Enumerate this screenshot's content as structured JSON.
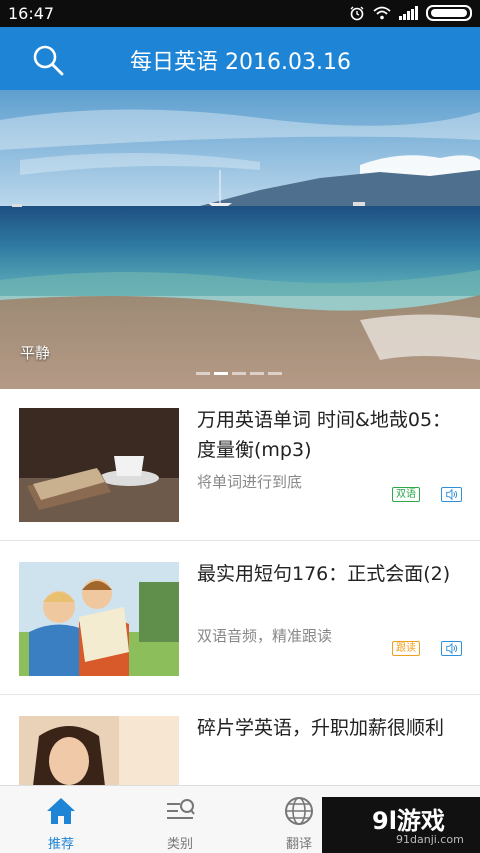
{
  "status_bar": {
    "time": "16:47"
  },
  "header": {
    "title": "每日英语 2016.03.16"
  },
  "banner": {
    "caption": "平静",
    "page_count": 5,
    "active_page": 2
  },
  "articles": [
    {
      "title": "万用英语单词 时间&地哉05：度量衡(mp3)",
      "subtitle": "将单词进行到底",
      "tag": "双语",
      "tag_color": "#2ca84a"
    },
    {
      "title": "最实用短句176：正式会面(2)",
      "subtitle": "双语音频，精准跟读",
      "tag": "跟读",
      "tag_color": "#f0a020"
    },
    {
      "title": "碎片学英语，升职加薪很顺利",
      "subtitle": "",
      "tag": "",
      "tag_color": ""
    }
  ],
  "bottom_nav": [
    {
      "label": "推荐",
      "icon": "home-icon",
      "active": true
    },
    {
      "label": "类别",
      "icon": "category-search-icon",
      "active": false
    },
    {
      "label": "翻译",
      "icon": "globe-icon",
      "active": false
    }
  ],
  "watermark": {
    "logo": "9l游戏",
    "url": "91danji.com"
  },
  "colors": {
    "primary": "#1d84d6",
    "status_bar": "#0d0d0d"
  }
}
